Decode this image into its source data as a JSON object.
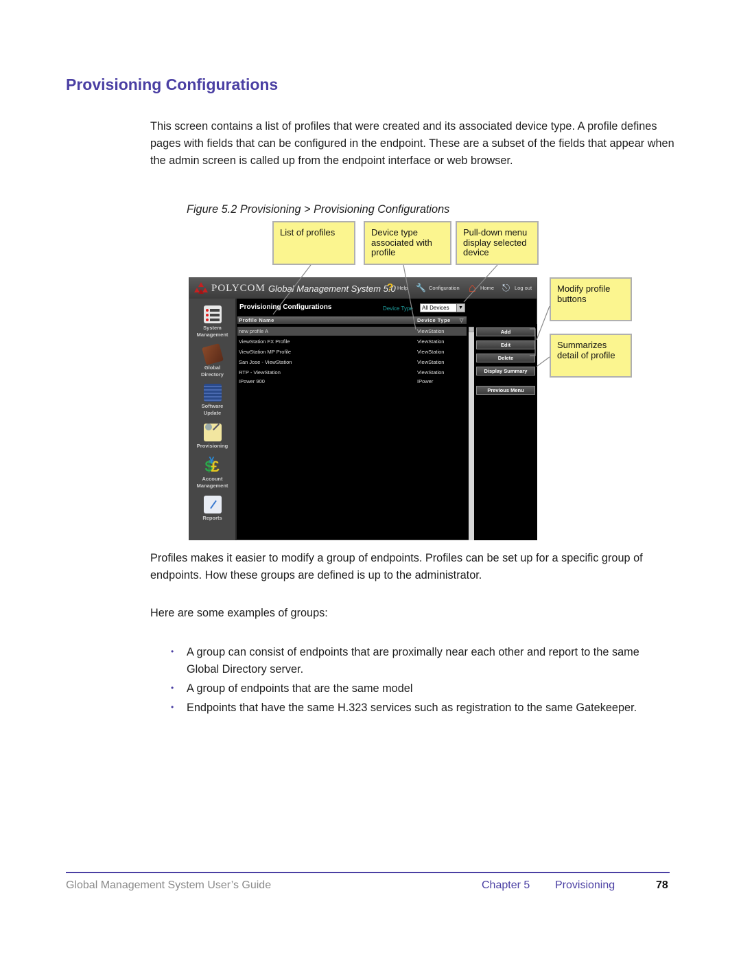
{
  "page": {
    "title": "Provisioning Configurations",
    "intro": "This screen contains a list of profiles that were created and its associated device type. A profile defines pages with fields that can be configured in the endpoint. These are a subset of the fields that appear when the admin screen is called up from the endpoint interface or web browser.",
    "figure_caption": "Figure 5.2 Provisioning > Provisioning Configurations",
    "para2": "Profiles makes it easier to modify a group of endpoints. Profiles can be set up for a specific group of endpoints. How these groups are defined is up to the administrator.",
    "para3": "Here are some examples of groups:",
    "bullet_char": "•",
    "bullets": [
      "A group can consist of endpoints that are proximally near each other and report to the same Global Directory server.",
      "A group of endpoints that are the same model",
      "Endpoints that have the same H.323 services such as registration to the same Gatekeeper."
    ]
  },
  "callouts": {
    "list_of_profiles": "List of profiles",
    "device_type": "Device type associated with profile",
    "pulldown": "Pull-down menu display selected device",
    "modify": "Modify profile buttons",
    "summarizes": "Summarizes detail of profile"
  },
  "app": {
    "brand": "POLYCOM",
    "product": "Global Management System 5.0",
    "header_links": {
      "help": "Help",
      "configuration": "Configuration",
      "home": "Home",
      "logout": "Log out"
    },
    "icons": {
      "help": "?",
      "configuration": "🔧",
      "home": "⌂",
      "logout": "⎋"
    },
    "sidebar": [
      {
        "label1": "System",
        "label2": "Management",
        "icon": "system-management-icon"
      },
      {
        "label1": "Global",
        "label2": "Directory",
        "icon": "global-directory-icon"
      },
      {
        "label1": "Software",
        "label2": "Update",
        "icon": "software-update-icon"
      },
      {
        "label1": "Provisioning",
        "label2": "",
        "icon": "provisioning-icon"
      },
      {
        "label1": "Account",
        "label2": "Management",
        "icon": "account-management-icon"
      },
      {
        "label1": "Reports",
        "label2": "",
        "icon": "reports-icon"
      }
    ],
    "content_title": "Provisioning Configurations",
    "device_type_label": "Device Type",
    "device_type_selected": "All Devices",
    "columns": {
      "profile_name": "Profile Name",
      "device_type": "Device Type"
    },
    "rows": [
      {
        "name": "new profile A",
        "type": "ViewStation",
        "selected": true
      },
      {
        "name": "ViewStation FX Profile",
        "type": "ViewStation",
        "selected": false
      },
      {
        "name": "ViewStation MP Profile",
        "type": "ViewStation",
        "selected": false
      },
      {
        "name": "San Jose - ViewStation",
        "type": "ViewStation",
        "selected": false
      },
      {
        "name": "RTP - ViewStation",
        "type": "ViewStation",
        "selected": false
      },
      {
        "name": "IPower 900",
        "type": "IPower",
        "selected": false
      }
    ],
    "buttons": {
      "add": "Add",
      "edit": "Edit",
      "delete": "Delete",
      "display_summary": "Display Summary",
      "previous_menu": "Previous Menu"
    }
  },
  "footer": {
    "guide": "Global Management System User’s Guide",
    "chapter": "Chapter 5",
    "section": "Provisioning",
    "page_number": "78"
  }
}
